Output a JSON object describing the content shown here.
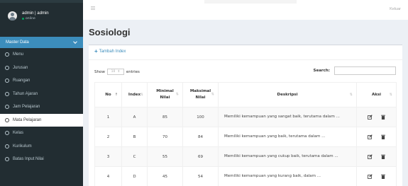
{
  "user": {
    "name": "admin | admin",
    "status": "online"
  },
  "sidebar": {
    "header": "Master Data",
    "items": [
      {
        "label": "Menu",
        "active": false
      },
      {
        "label": "Jurusan",
        "active": false
      },
      {
        "label": "Ruangan",
        "active": false
      },
      {
        "label": "Tahun Ajaran",
        "active": false
      },
      {
        "label": "Jam Pelajaran",
        "active": false
      },
      {
        "label": "Mata Pelajaran",
        "active": true
      },
      {
        "label": "Kelas",
        "active": false
      },
      {
        "label": "Kurikulum",
        "active": false
      },
      {
        "label": "Batas Input Nilai",
        "active": false
      }
    ]
  },
  "topbar": {
    "logout": "Keluar"
  },
  "page": {
    "title": "Sosiologi"
  },
  "toolbar": {
    "add_label": "Tambah Index"
  },
  "table_controls": {
    "show_prefix": "Show",
    "show_value": "10",
    "show_suffix": "entries",
    "search_label": "Search:"
  },
  "table": {
    "columns": [
      {
        "l1": "",
        "l2": "No"
      },
      {
        "l1": "",
        "l2": "Index"
      },
      {
        "l1": "Minimal",
        "l2": "Nilai"
      },
      {
        "l1": "Maksimal",
        "l2": "Nilai"
      },
      {
        "l1": "",
        "l2": "Deskripsi"
      },
      {
        "l1": "",
        "l2": "Aksi"
      }
    ],
    "rows": [
      {
        "no": "1",
        "index": "A",
        "min": "85",
        "max": "100",
        "desc": "Memiliki kemampuan yang sangat baik, terutama dalam ..."
      },
      {
        "no": "2",
        "index": "B",
        "min": "70",
        "max": "84",
        "desc": "Memiliki kemampuan yang baik, terutama dalam ..."
      },
      {
        "no": "3",
        "index": "C",
        "min": "55",
        "max": "69",
        "desc": "Memiliki kemampuan yang cukup baik, terutama dalam ..."
      },
      {
        "no": "4",
        "index": "D",
        "min": "45",
        "max": "54",
        "desc": "Memiliki kemampuan yang kurang baik, dalam ..."
      }
    ]
  },
  "icons": {
    "add": "plus-icon",
    "edit": "edit-icon",
    "delete": "trash-icon",
    "toggle": "hamburger-icon"
  },
  "colors": {
    "accent": "#3c8dbc",
    "sidebar": "#222d32",
    "online": "#00a65a"
  }
}
